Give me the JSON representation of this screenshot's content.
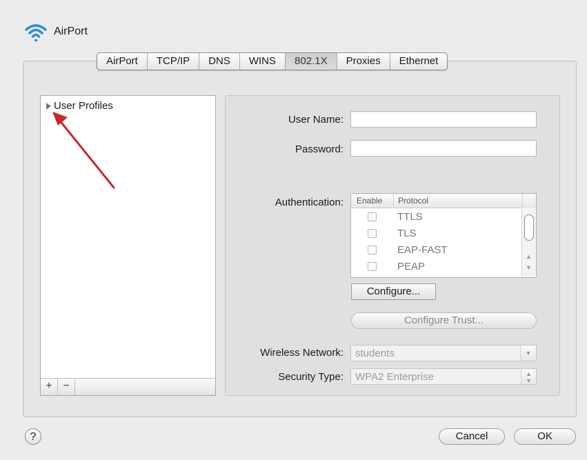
{
  "window": {
    "title": "AirPort"
  },
  "tabs": [
    {
      "label": "AirPort",
      "active": false
    },
    {
      "label": "TCP/IP",
      "active": false
    },
    {
      "label": "DNS",
      "active": false
    },
    {
      "label": "WINS",
      "active": false
    },
    {
      "label": "802.1X",
      "active": true
    },
    {
      "label": "Proxies",
      "active": false
    },
    {
      "label": "Ethernet",
      "active": false
    }
  ],
  "profiles": {
    "item_label": "User Profiles",
    "add_label": "+",
    "remove_label": "−"
  },
  "form": {
    "username_label": "User Name:",
    "username_value": "",
    "password_label": "Password:",
    "password_value": "",
    "auth_label": "Authentication:",
    "auth_headers": {
      "enable": "Enable",
      "protocol": "Protocol"
    },
    "protocols": [
      {
        "name": "TTLS",
        "enabled": false
      },
      {
        "name": "TLS",
        "enabled": false
      },
      {
        "name": "EAP-FAST",
        "enabled": false
      },
      {
        "name": "PEAP",
        "enabled": false
      }
    ],
    "configure_label": "Configure...",
    "configure_trust_label": "Configure Trust...",
    "wireless_label": "Wireless Network:",
    "wireless_value": "students",
    "security_label": "Security Type:",
    "security_value": "WPA2 Enterprise"
  },
  "footer": {
    "help_label": "?",
    "cancel_label": "Cancel",
    "ok_label": "OK"
  },
  "annotation": {
    "arrow_color": "#c8262c"
  },
  "colors": {
    "wifi_icon": "#2a8fd6"
  }
}
